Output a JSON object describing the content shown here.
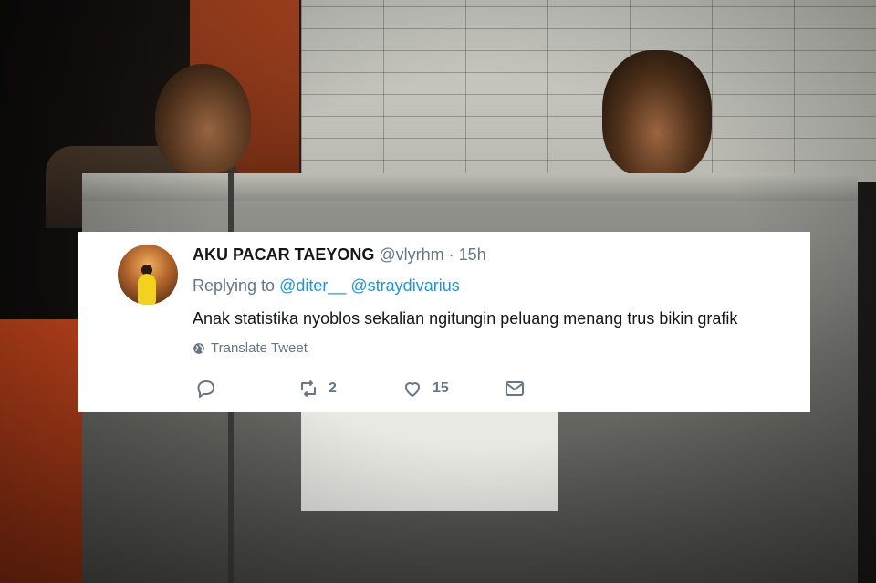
{
  "tweet": {
    "display_name": "AKU PACAR TAEYONG",
    "handle": "@vlyrhm",
    "separator": "·",
    "time": "15h",
    "replying_prefix": "Replying to",
    "mentions": [
      "@diter__",
      "@straydivarius"
    ],
    "text": "Anak statistika nyoblos sekalian ngitungin peluang menang trus bikin grafik",
    "translate_label": "Translate Tweet"
  },
  "actions": {
    "reply_icon": "reply-icon",
    "retweet_icon": "retweet-icon",
    "retweet_count": "2",
    "like_icon": "heart-icon",
    "like_count": "15",
    "dm_icon": "envelope-icon"
  },
  "colors": {
    "text_primary": "#14171a",
    "text_secondary": "#657786",
    "link": "#1b95e0",
    "card_bg": "#ffffff"
  }
}
